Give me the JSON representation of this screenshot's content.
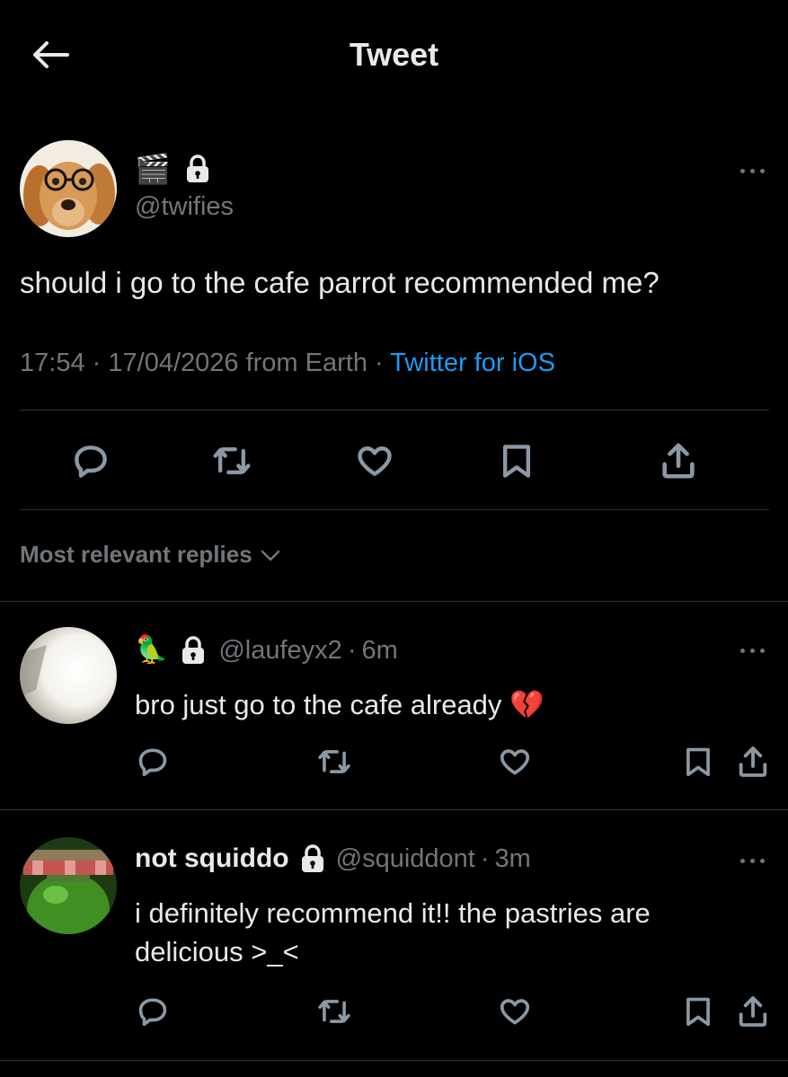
{
  "header": {
    "title": "Tweet",
    "back_icon": "arrow-left-icon"
  },
  "tweet": {
    "display_emojis": "🎬",
    "handle": "@twifies",
    "text": "should i go to the cafe parrot recommended me?",
    "time": "17:54",
    "sep1": "·",
    "date": "17/04/2026",
    "from": "from Earth",
    "sep2": "·",
    "source": "Twitter for iOS",
    "actions": [
      "reply-icon",
      "retweet-icon",
      "like-icon",
      "bookmark-icon",
      "share-icon"
    ]
  },
  "replies_section": {
    "label": "Most relevant replies",
    "chevron": "chevron-down-icon"
  },
  "replies": [
    {
      "name": "",
      "name_emoji": "🦜",
      "handle": "@laufeyx2",
      "sep": "·",
      "time": "6m",
      "text": "bro just go to the cafe already 💔"
    },
    {
      "name": "not squiddo",
      "handle": "@squiddont",
      "sep": "·",
      "time": "3m",
      "text": "i definitely recommend it!! the pastries are delicious >_<"
    }
  ],
  "colors": {
    "background": "#000000",
    "text": "#e7e9ea",
    "muted": "#71767b",
    "link": "#1d9bf0",
    "divider": "#2f3336"
  }
}
